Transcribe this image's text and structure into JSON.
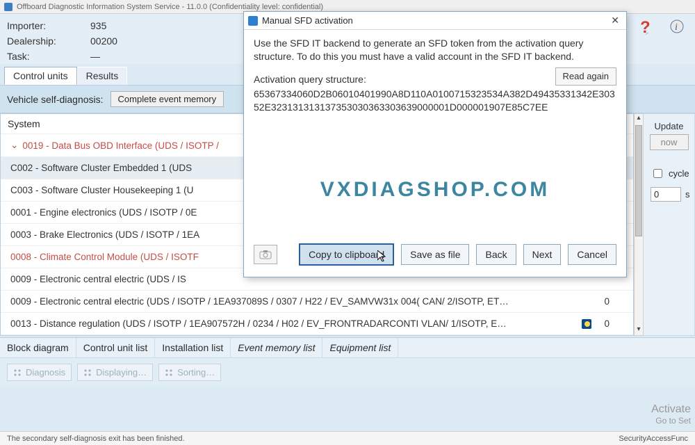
{
  "window": {
    "title": "Offboard Diagnostic Information System Service - 11.0.0  (Confidentiality level: confidential)"
  },
  "header": {
    "labels": {
      "importer": "Importer:",
      "dealership": "Dealership:",
      "task": "Task:"
    },
    "values": {
      "importer": "935",
      "dealership": "00200",
      "task": "—"
    }
  },
  "tabs": {
    "control_units": "Control units",
    "results": "Results"
  },
  "selfdiag": {
    "label": "Vehicle self-diagnosis:",
    "button": "Complete event memory"
  },
  "system": {
    "header": "System",
    "items": [
      {
        "name": "0019",
        "label": "0019 - Data Bus OBD Interface  (UDS / ISOTP /",
        "red": true,
        "expand": "⌄"
      },
      {
        "name": "c002",
        "label": "C002 - Software Cluster Embedded 1  (UDS",
        "red": false,
        "hl": true
      },
      {
        "name": "c003",
        "label": "C003 - Software Cluster Housekeeping 1  (U",
        "red": false
      },
      {
        "name": "0001",
        "label": "0001 - Engine electronics  (UDS / ISOTP / 0E",
        "red": false
      },
      {
        "name": "0003",
        "label": "0003 - Brake Electronics  (UDS / ISOTP / 1EA",
        "red": false
      },
      {
        "name": "0008",
        "label": "0008 - Climate Control Module  (UDS / ISOTF",
        "red": true
      },
      {
        "name": "0009a",
        "label": "0009 - Electronic central electric  (UDS / IS",
        "red": false
      },
      {
        "name": "0009b",
        "label": "0009 - Electronic central electric  (UDS / ISOTP / 1EA937089S / 0307 / H22 / EV_SAMVW31x 004( CAN/ 2/ISOTP, ET…",
        "red": false,
        "count": "0"
      },
      {
        "name": "0013",
        "label": "0013 - Distance regulation  (UDS / ISOTP / 1EA907572H / 0234 / H02 / EV_FRONTRADARCONTI VLAN/ 1/ISOTP, E…",
        "red": false,
        "count": "0",
        "moon": true
      }
    ]
  },
  "side": {
    "update_label": "Update",
    "now_btn": "now",
    "cycle_label": "cycle",
    "seconds_value": "0",
    "seconds_unit": "s"
  },
  "bottom_tabs": {
    "block_diagram": "Block diagram",
    "control_unit_list": "Control unit list",
    "installation_list": "Installation list",
    "event_memory_list": "Event memory list",
    "equipment_list": "Equipment list"
  },
  "bottom_buttons": {
    "diagnosis": "Diagnosis",
    "displaying": "Displaying…",
    "sorting": "Sorting…"
  },
  "activate": {
    "line1": "Activate",
    "line2": "Go to Set"
  },
  "statusbar": {
    "left": "The secondary self-diagnosis exit has been finished.",
    "right": "SecurityAccessFunc"
  },
  "modal": {
    "title": "Manual SFD activation",
    "text": "Use the SFD IT backend to generate an SFD token from the activation query structure. To do this you must have a valid account in the SFD IT backend.",
    "struct_label": "Activation query structure:",
    "hex": "65367334060D2B06010401990A8D110A0100715323534A382D49435331342E30352E323131313137353030363303639000001D000001907E85C7EE",
    "read_again": "Read again",
    "watermark": "VXDIAGSHOP.COM",
    "buttons": {
      "copy": "Copy to clipboard",
      "save": "Save as file",
      "back": "Back",
      "next": "Next",
      "cancel": "Cancel"
    }
  }
}
